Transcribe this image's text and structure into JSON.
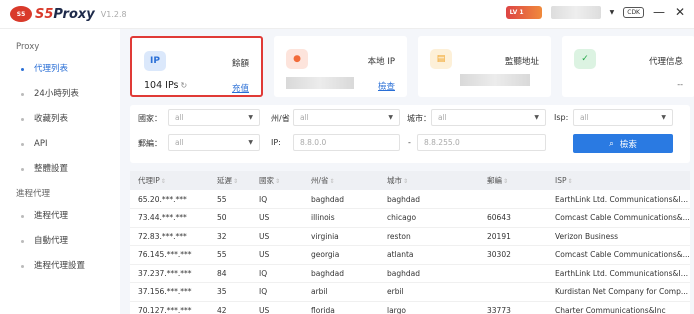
{
  "app": {
    "logo_badge": "S5",
    "name_prefix": "S5",
    "name_suffix": "Proxy",
    "version": "V1.2.8"
  },
  "titlebar": {
    "level": "LV 1",
    "cdk": "CDK",
    "minimize": "—",
    "close": "✕"
  },
  "sidebar": {
    "section1": "Proxy",
    "items1": [
      {
        "label": "代理列表"
      },
      {
        "label": "24小時列表"
      },
      {
        "label": "收藏列表"
      },
      {
        "label": "API"
      },
      {
        "label": "整體設置"
      }
    ],
    "section2": "進程代理",
    "items2": [
      {
        "label": "進程代理"
      },
      {
        "label": "自動代理"
      },
      {
        "label": "進程代理設置"
      }
    ]
  },
  "cards": {
    "ip": {
      "icon": "IP",
      "title": "餘額",
      "value": "104 IPs",
      "link": "充值"
    },
    "local": {
      "title": "本地 IP",
      "link": "檢查"
    },
    "listen": {
      "title": "監聽地址"
    },
    "proxy": {
      "title": "代理信息",
      "value": "--"
    }
  },
  "filters": {
    "country_label": "國家：",
    "country_value": "all",
    "state_label": "州/省",
    "state_value": "all",
    "city_label": "城市：",
    "city_value": "all",
    "isp_label": "Isp:",
    "isp_value": "all",
    "zip_label": "郵編：",
    "zip_value": "all",
    "ip_label": "IP:",
    "ip_from": "8.8.0.0",
    "ip_sep": "-",
    "ip_to": "8.8.255.0",
    "search_label": "檢索"
  },
  "table": {
    "headers": [
      "代理IP",
      "延遲",
      "國家",
      "州/省",
      "城市",
      "郵編",
      "ISP"
    ],
    "rows": [
      [
        "65.20.***.***",
        "55",
        "IQ",
        "baghdad",
        "baghdad",
        "",
        "EarthLink Ltd. Communications&In..."
      ],
      [
        "73.44.***.***",
        "50",
        "US",
        "illinois",
        "chicago",
        "60643",
        "Comcast Cable Communications&..."
      ],
      [
        "72.83.***.***",
        "32",
        "US",
        "virginia",
        "reston",
        "20191",
        "Verizon Business"
      ],
      [
        "76.145.***.***",
        "55",
        "US",
        "georgia",
        "atlanta",
        "30302",
        "Comcast Cable Communications&..."
      ],
      [
        "37.237.***.***",
        "84",
        "IQ",
        "baghdad",
        "baghdad",
        "",
        "EarthLink Ltd. Communications&In..."
      ],
      [
        "37.156.***.***",
        "35",
        "IQ",
        "arbil",
        "erbil",
        "",
        "Kurdistan Net Company for Comp..."
      ],
      [
        "70.127.***.***",
        "42",
        "US",
        "florida",
        "largo",
        "33773",
        "Charter Communications&Inc"
      ]
    ]
  }
}
